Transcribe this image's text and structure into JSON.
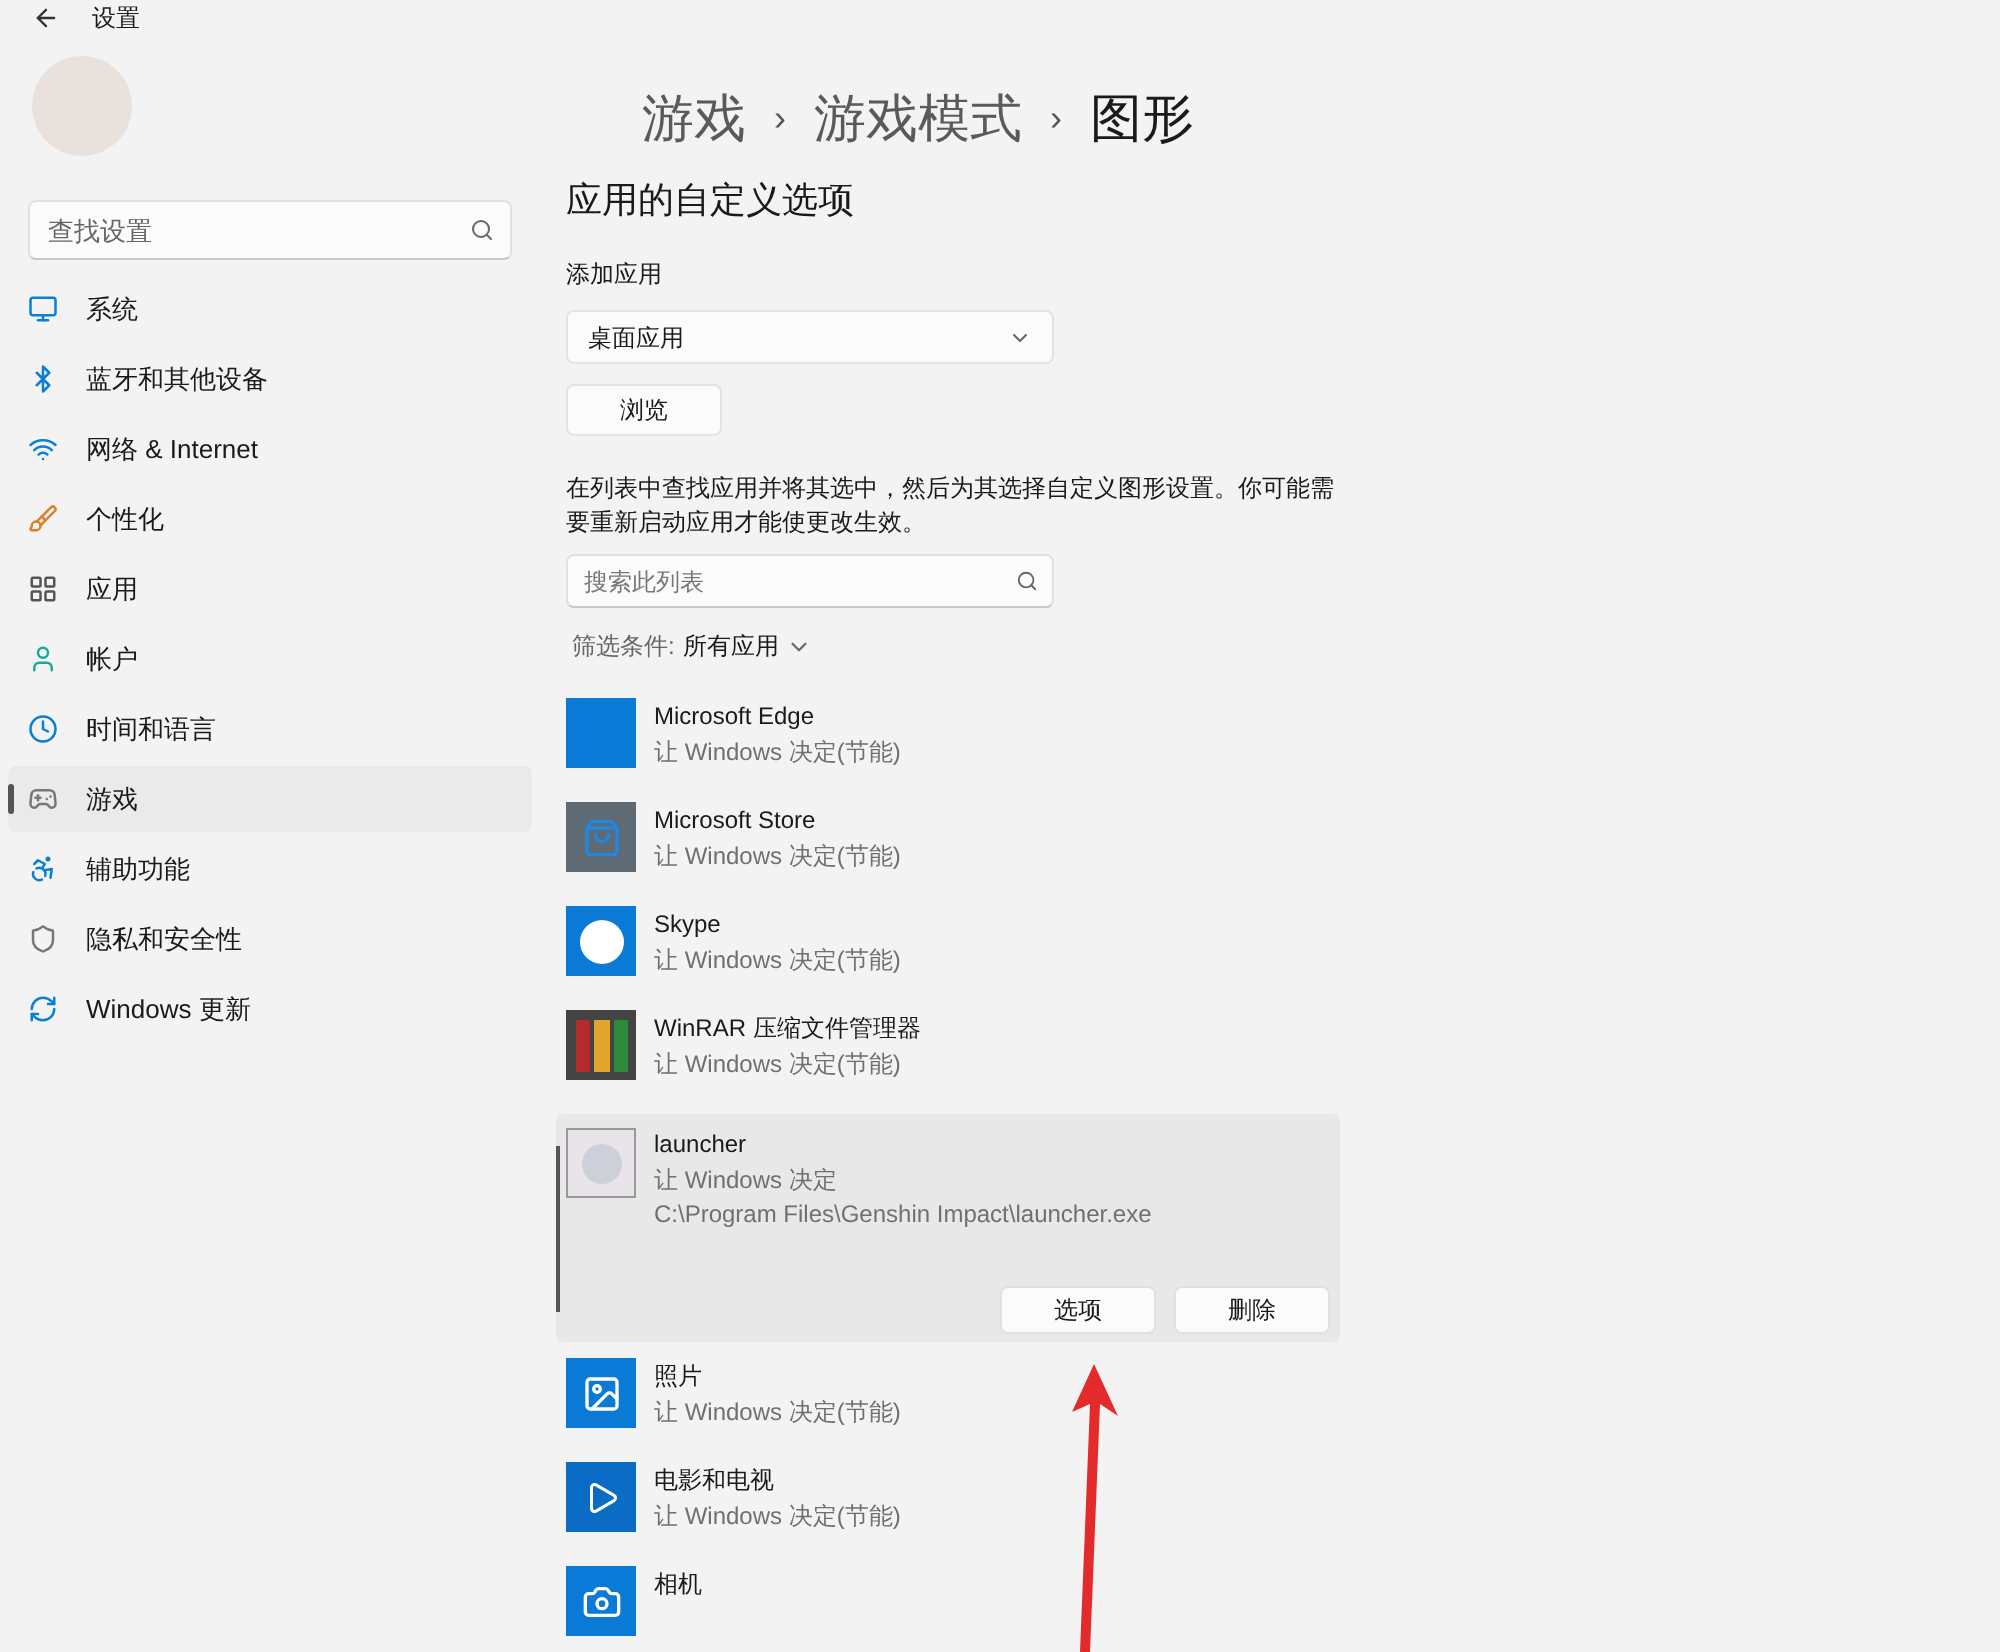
{
  "window": {
    "title": "设置"
  },
  "sidebar": {
    "search": {
      "placeholder": "查找设置"
    },
    "items": [
      {
        "label": "系统",
        "selected": false
      },
      {
        "label": "蓝牙和其他设备",
        "selected": false
      },
      {
        "label": "网络 & Internet",
        "selected": false
      },
      {
        "label": "个性化",
        "selected": false
      },
      {
        "label": "应用",
        "selected": false
      },
      {
        "label": "帐户",
        "selected": false
      },
      {
        "label": "时间和语言",
        "selected": false
      },
      {
        "label": "游戏",
        "selected": true
      },
      {
        "label": "辅助功能",
        "selected": false
      },
      {
        "label": "隐私和安全性",
        "selected": false
      },
      {
        "label": "Windows 更新",
        "selected": false
      }
    ]
  },
  "breadcrumb": [
    "游戏",
    "游戏模式",
    "图形"
  ],
  "breadcrumb_separator": "›",
  "section_title": "应用的自定义选项",
  "add_app": {
    "label": "添加应用",
    "dropdown": "桌面应用",
    "browse_button": "浏览"
  },
  "description": "在列表中查找应用并将其选中，然后为其选择自定义图形设置。你可能需要重新启动应用才能使更改生效。",
  "list_search": {
    "placeholder": "搜索此列表"
  },
  "filter": {
    "label": "筛选条件:",
    "value": "所有应用"
  },
  "apps": [
    {
      "name": "Microsoft Edge",
      "status": "让 Windows 决定(节能)",
      "expanded": false
    },
    {
      "name": "Microsoft Store",
      "status": "让 Windows 决定(节能)",
      "expanded": false
    },
    {
      "name": "Skype",
      "status": "让 Windows 决定(节能)",
      "expanded": false
    },
    {
      "name": "WinRAR 压缩文件管理器",
      "status": "让 Windows 决定(节能)",
      "expanded": false
    },
    {
      "name": "launcher",
      "status": "让 Windows 决定",
      "path": "C:\\Program Files\\Genshin Impact\\launcher.exe",
      "expanded": true,
      "buttons": [
        "选项",
        "删除"
      ]
    },
    {
      "name": "照片",
      "status": "让 Windows 决定(节能)",
      "expanded": false
    },
    {
      "name": "电影和电视",
      "status": "让 Windows 决定(节能)",
      "expanded": false
    },
    {
      "name": "相机",
      "expanded": false
    }
  ]
}
